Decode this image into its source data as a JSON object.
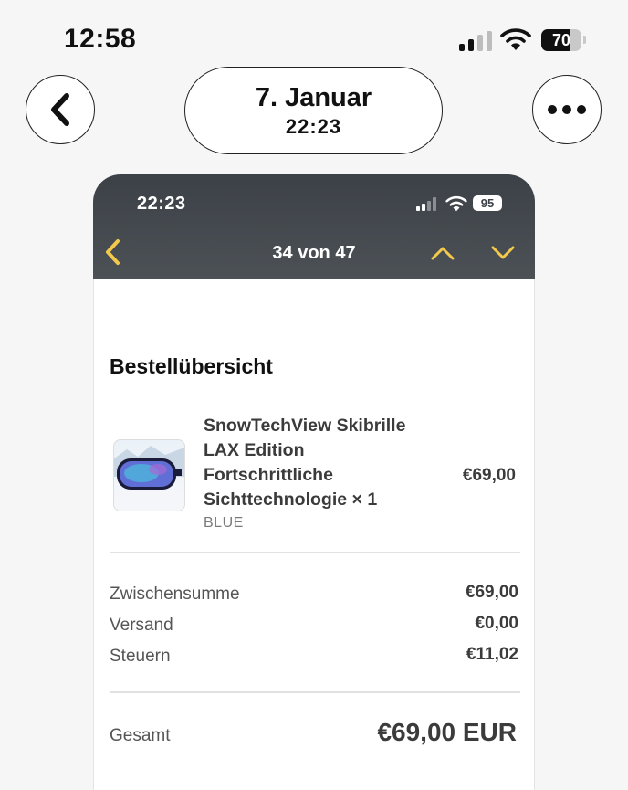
{
  "status_bar": {
    "time": "12:58",
    "battery": "70"
  },
  "header": {
    "date": "7. Januar",
    "time": "22:23"
  },
  "inner_screenshot": {
    "status_bar": {
      "time": "22:23",
      "battery": "95"
    },
    "nav": {
      "counter": "34 von 47"
    },
    "order": {
      "title": "Bestellübersicht",
      "item": {
        "name": "SnowTechView Skibrille LAX Edition Fortschrittliche Sichttechnologie × 1",
        "variant": "BLUE",
        "price": "€69,00"
      },
      "summary": [
        {
          "label": "Zwischensumme",
          "value": "€69,00"
        },
        {
          "label": "Versand",
          "value": "€0,00"
        },
        {
          "label": "Steuern",
          "value": "€11,02"
        }
      ],
      "total": {
        "label": "Gesamt",
        "value": "€69,00 EUR"
      }
    }
  },
  "colors": {
    "nav_accent": "#f2c94c",
    "nav_background": "#43484e"
  },
  "icons": [
    "chevron-left-icon",
    "more-horizontal-icon",
    "cellular-signal-icon",
    "wifi-icon",
    "battery-icon",
    "chevron-up-icon",
    "chevron-down-icon"
  ]
}
